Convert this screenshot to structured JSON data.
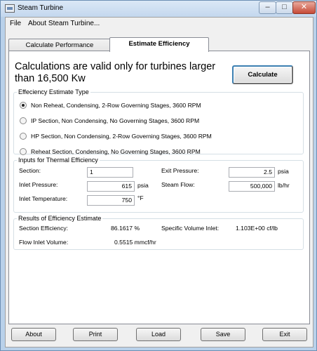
{
  "window": {
    "title": "Steam Turbine",
    "controls": {
      "minimize": "–",
      "maximize": "□",
      "close": "✕"
    }
  },
  "menu": [
    {
      "label": "File"
    },
    {
      "label": "About Steam Turbine..."
    }
  ],
  "tabs": [
    {
      "label": "Calculate Performance",
      "active": false
    },
    {
      "label": "Estimate Efficiency",
      "active": true
    }
  ],
  "notice": "Calculations are valid only for turbines larger than 16,500 Kw",
  "calculate_label": "Calculate",
  "efficiency_type": {
    "legend": "Effeciency Estimate Type",
    "options": [
      {
        "label": "Non Reheat, Condensing, 2-Row Governing Stages, 3600 RPM",
        "checked": true
      },
      {
        "label": "IP Section, Non Condensing, No Governing Stages, 3600 RPM",
        "checked": false
      },
      {
        "label": "HP Section, Non Condensing, 2-Row Governing Stages, 3600 RPM",
        "checked": false
      },
      {
        "label": "Reheat Section, Condensing, No Governing Stages, 3600 RPM",
        "checked": false
      }
    ]
  },
  "inputs": {
    "legend": "Inputs for Thermal Efficiency",
    "section": {
      "label": "Section:",
      "value": "1"
    },
    "inlet_pressure": {
      "label": "Inlet Pressure:",
      "value": "615",
      "unit": "psia"
    },
    "inlet_temperature": {
      "label": "Inlet Temperature:",
      "value": "750",
      "unit": "°F"
    },
    "exit_pressure": {
      "label": "Exit Pressure:",
      "value": "2.5",
      "unit": "psia"
    },
    "steam_flow": {
      "label": "Steam Flow:",
      "value": "500,000",
      "unit": "lb/hr"
    }
  },
  "results": {
    "legend": "Results of Efficiency Estimate",
    "section_efficiency": {
      "label": "Section Efficiency:",
      "value": "86.1617 %"
    },
    "specific_volume_inlet": {
      "label": "Specific Volume Inlet:",
      "value": "1.103E+00 cf/lb"
    },
    "flow_inlet_volume": {
      "label": "Flow Inlet Volume:",
      "value": "0.5515 mmcf/hr"
    }
  },
  "buttons": {
    "about": "About",
    "print": "Print",
    "load": "Load",
    "save": "Save",
    "exit": "Exit"
  }
}
